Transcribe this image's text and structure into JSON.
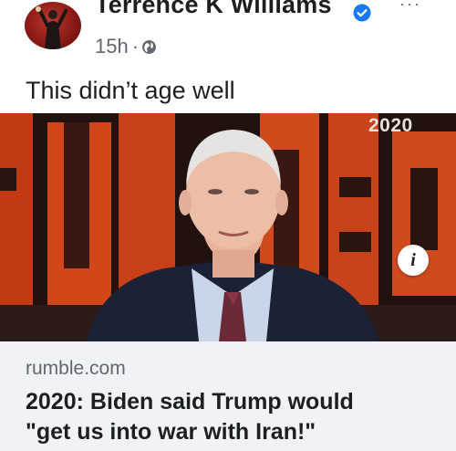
{
  "post": {
    "author": "Terrence K Williams",
    "verified": true,
    "timestamp": "15h",
    "separator": "·",
    "text": "This didn’t age well",
    "more_icon": "ellipsis-icon",
    "audience_icon": "globe-icon"
  },
  "media": {
    "overlay_year": "2020",
    "info_icon_glyph": "i"
  },
  "link_preview": {
    "domain": "rumble.com",
    "title_line1": "2020: Biden said Trump would",
    "title_line2": "\"get us into war with Iran!\""
  },
  "colors": {
    "verified_blue": "#1877f2",
    "text_primary": "#1c1e21",
    "text_secondary": "#606770",
    "preview_bg": "#f0f2f5"
  }
}
